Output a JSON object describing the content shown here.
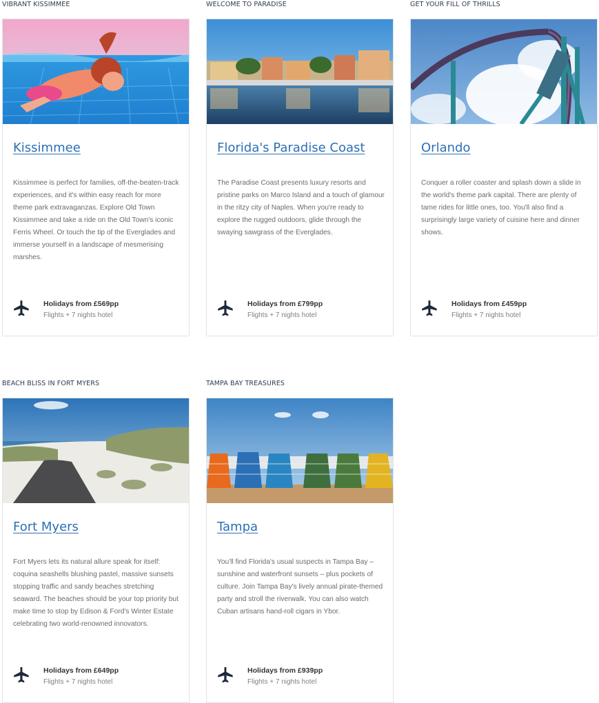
{
  "cards": [
    {
      "eyebrow": "VIBRANT KISSIMMEE",
      "title": "Kissimmee",
      "description": "Kissimmee is perfect for families, off-the-beaten-track experiences, and it's within easy reach for more theme park extravaganzas. Explore Old Town Kissimmee and take a ride on the Old Town's iconic Ferris Wheel. Or touch the tip of the Everglades and immerse yourself in a landscape of mesmerising marshes.",
      "price": "Holidays from £569pp",
      "price_detail": "Flights + 7 nights hotel"
    },
    {
      "eyebrow": "WELCOME TO PARADISE",
      "title": "Florida's Paradise Coast",
      "description": "The Paradise Coast presents luxury resorts and pristine parks on Marco Island and a touch of glamour in the ritzy city of Naples. When you're ready to explore the rugged outdoors, glide through the swaying sawgrass of the Everglades.",
      "price": "Holidays from £799pp",
      "price_detail": "Flights + 7 nights hotel"
    },
    {
      "eyebrow": "GET YOUR FILL OF THRILLS",
      "title": "Orlando",
      "description": "Conquer a roller coaster and splash down a slide in the world's theme park capital. There are plenty of tame rides for little ones, too. You'll also find a surprisingly large variety of cuisine here and dinner shows.",
      "price": "Holidays from £459pp",
      "price_detail": "Flights + 7 nights hotel"
    },
    {
      "eyebrow": "BEACH BLISS IN FORT MYERS",
      "title": "Fort Myers",
      "description": "Fort Myers lets its natural allure speak for itself: coquina seashells blushing pastel, massive sunsets stopping traffic and sandy beaches stretching seaward. The beaches should be your top priority but make time to stop by Edison & Ford's Winter Estate celebrating two world-renowned innovators.",
      "price": "Holidays from £649pp",
      "price_detail": "Flights + 7 nights hotel"
    },
    {
      "eyebrow": "TAMPA BAY TREASURES",
      "title": "Tampa",
      "description": "You'll find Florida's usual suspects in Tampa Bay – sunshine and waterfront sunsets – plus pockets of culture. Join Tampa Bay's lively annual pirate-themed party and stroll the riverwalk. You can also watch Cuban artisans hand-roll cigars in Ybor.",
      "price": "Holidays from £939pp",
      "price_detail": "Flights + 7 nights hotel"
    }
  ],
  "icons": {
    "price": "airplane-icon"
  },
  "colors": {
    "link": "#2c6fb3",
    "eyebrow": "#2f3b4f",
    "border": "#dfe3e8",
    "icon": "#1e2a3a"
  }
}
